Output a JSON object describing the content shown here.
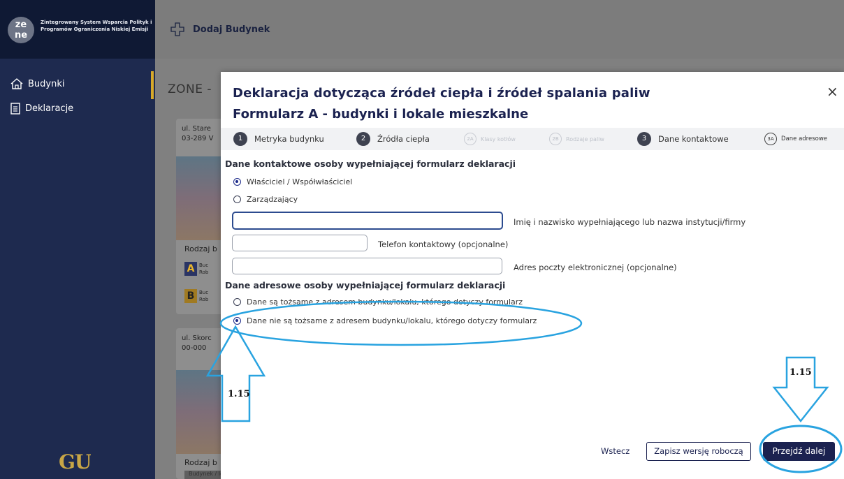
{
  "sidebar": {
    "logo_mark": "ze ne",
    "logo_text": "Zintegrowany System Wsparcia Polityk i Programów Ograniczenia Niskiej Emisji",
    "items": [
      {
        "label": "Budynki",
        "icon": "house-icon"
      },
      {
        "label": "Deklaracje",
        "icon": "clipboard-icon"
      }
    ],
    "footer_logo": "GU"
  },
  "topbar": {
    "add_label": "Dodaj Budynek",
    "add_icon": "plus-outline-icon"
  },
  "background": {
    "heading": "ZONE -",
    "cards": [
      {
        "street": "ul. Stare",
        "code": "03-289 V",
        "rodzaj": "Rodzaj b"
      },
      {
        "street": "ul. Skorc",
        "code": "00-000",
        "rodzaj": "Rodzaj b"
      }
    ],
    "badges": [
      "A",
      "B"
    ],
    "badge_lines": [
      [
        "Buc",
        "Rob"
      ],
      [
        "Buc",
        "Rob"
      ]
    ],
    "bottom_strip": "Budynek / lokal mieszkalny"
  },
  "modal": {
    "title": "Deklaracja dotycząca źródeł ciepła i źródeł spalania paliw",
    "subtitle": "Formularz A - budynki i lokale mieszkalne",
    "steps": [
      {
        "num": "1",
        "label": "Metryka budynku",
        "state": "done"
      },
      {
        "num": "2",
        "label": "Źródła ciepła",
        "state": "done"
      },
      {
        "num": "2A",
        "label": "Klasy kotłów",
        "state": "disabled"
      },
      {
        "num": "2B",
        "label": "Rodzaje paliw",
        "state": "disabled"
      },
      {
        "num": "3",
        "label": "Dane kontaktowe",
        "state": "active"
      },
      {
        "num": "3A",
        "label": "Dane adresowe",
        "state": "sub"
      }
    ],
    "contact_section_title": "Dane kontaktowe osoby wypełniającej formularz deklaracji",
    "contact_options": [
      {
        "label": "Właściciel / Współwłaściciel",
        "selected": true
      },
      {
        "label": "Zarządzający",
        "selected": false
      }
    ],
    "fields": {
      "name": {
        "value": "",
        "label": "Imię i nazwisko wypełniającego lub nazwa instytucji/firmy"
      },
      "phone": {
        "value": "",
        "label": "Telefon kontaktowy (opcjonalne)"
      },
      "email": {
        "value": "",
        "label": "Adres poczty elektronicznej (opcjonalne)"
      }
    },
    "address_section_title": "Dane adresowe osoby wypełniającej formularz deklaracji",
    "address_options": [
      {
        "label": "Dane są tożsame z adresem budynku/lokalu, którego dotyczy formularz",
        "selected": false
      },
      {
        "label": "Dane nie są tożsame z adresem budynku/lokalu, którego dotyczy formularz",
        "selected": true
      }
    ],
    "buttons": {
      "back": "Wstecz",
      "draft": "Zapisz wersję roboczą",
      "next": "Przejdź dalej"
    },
    "close": "×"
  },
  "annotations": {
    "left_label": "1.15",
    "right_label": "1.15",
    "color": "#29a3e0"
  }
}
